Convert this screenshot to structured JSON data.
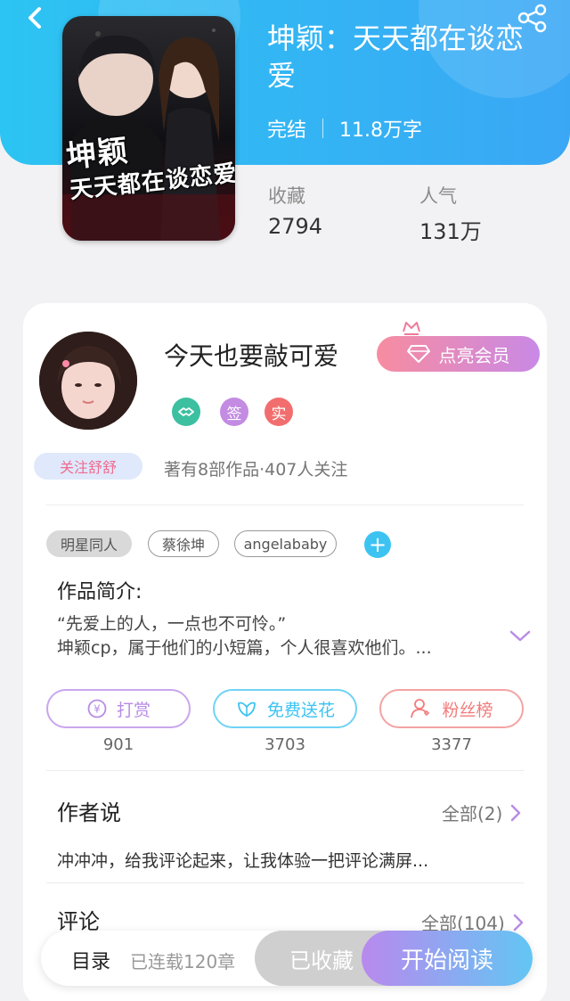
{
  "header": {
    "back_icon": "chevron-left-icon",
    "share_icon": "share-icon",
    "book_title": "坤颖：天天都在谈恋爱",
    "status": "完结",
    "word_count": "11.8万字"
  },
  "cover": {
    "title_line1": "坤颖",
    "title_line2": "天天都在谈恋爱"
  },
  "stats": {
    "favorites_label": "收藏",
    "favorites_value": "2794",
    "popularity_label": "人气",
    "popularity_value": "131万"
  },
  "author": {
    "name": "今天也要敲可爱",
    "vip_label": "点亮会员",
    "badge_sign": "签",
    "badge_real": "实",
    "follow_label": "关注舒舒",
    "meta": "著有8部作品·407人关注"
  },
  "tags": {
    "items": [
      "明星同人",
      "蔡徐坤",
      "angelababy"
    ],
    "add_label": "+"
  },
  "intro": {
    "title": "作品简介:",
    "line1": "“先爱上的人，一点也不可怜。”",
    "line2": "坤颖cp，属于他们的小短篇，个人很喜欢他们。..."
  },
  "actions": [
    {
      "label": "打赏",
      "count": "901",
      "color": "#b88be6",
      "icon": "yuan-coin-icon"
    },
    {
      "label": "免费送花",
      "count": "3703",
      "color": "#3cc3f2",
      "icon": "flower-icon"
    },
    {
      "label": "粉丝榜",
      "count": "3377",
      "color": "#f27b7b",
      "icon": "fan-user-icon"
    }
  ],
  "author_says": {
    "title": "作者说",
    "more": "全部(2)",
    "text": "冲冲冲，给我评论起来，让我体验一把评论满屏..."
  },
  "comments": {
    "title": "评论",
    "more": "全部(104)"
  },
  "bottom_bar": {
    "toc_label": "目录",
    "toc_status": "已连载120章",
    "collected_label": "已收藏",
    "read_label": "开始阅读"
  },
  "colors": {
    "header_gradient_start": "#2cc4f2",
    "header_gradient_end": "#3aa7f5",
    "vip_gradient_start": "#f78ca0",
    "vip_gradient_end": "#c989e6",
    "badge_sign": "#c38be2",
    "badge_real": "#f26e6e",
    "badge_medal": "#3cc0a0"
  }
}
